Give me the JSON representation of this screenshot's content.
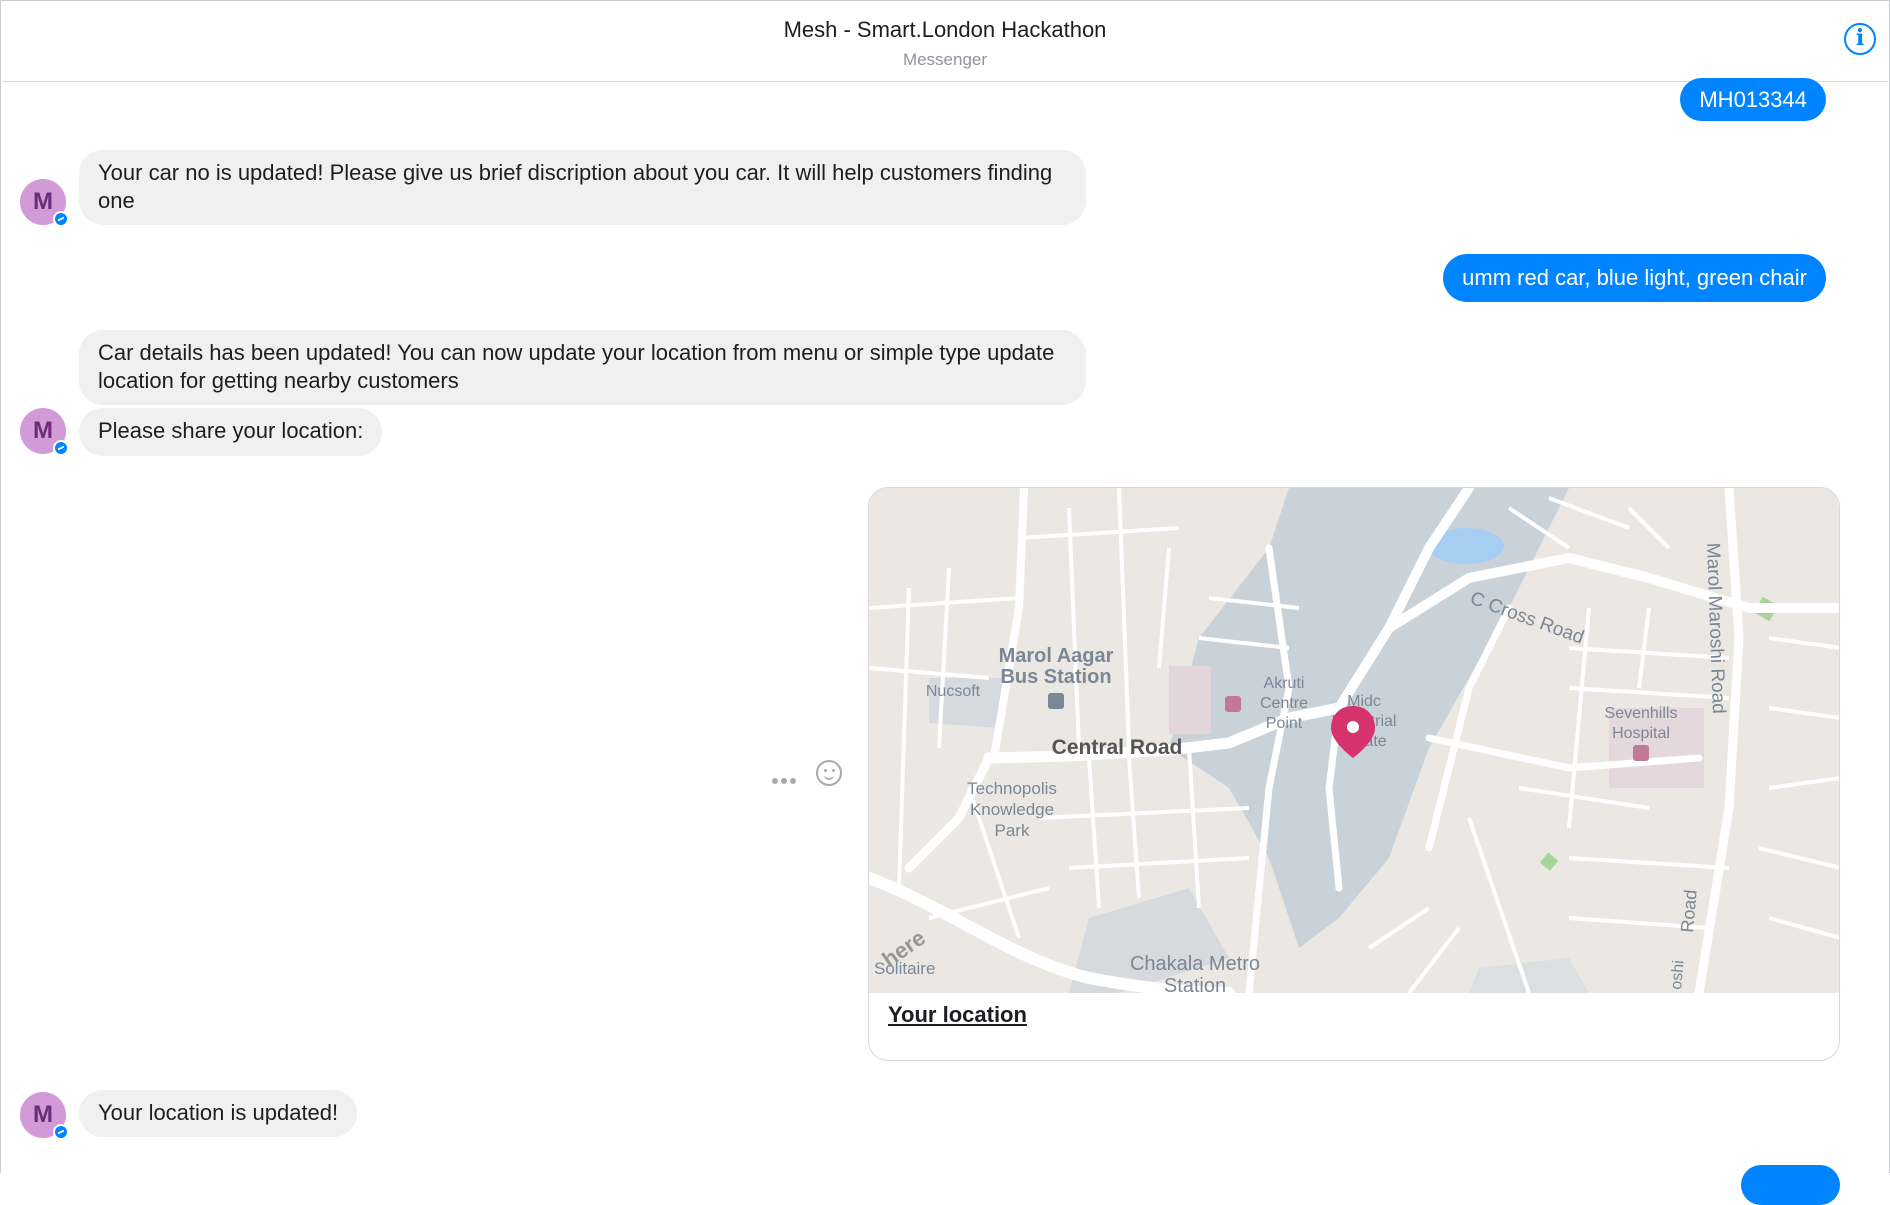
{
  "header": {
    "title": "Mesh - Smart.London Hackathon",
    "subtitle": "Messenger",
    "info_icon": "info-icon"
  },
  "bot": {
    "avatar_letter": "M",
    "avatar_color": "#d39ad8",
    "badge_icon": "messenger-badge-icon"
  },
  "messages": {
    "out_car_no": "MH013344",
    "in_car_updated": "Your car no is updated! Please give us brief discription about you car. It will help customers finding one",
    "out_description": "umm red car, blue light, green chair",
    "in_details_updated": "Car details has been updated! You can now update your location from menu or simple type update location for getting nearby customers",
    "in_share_location": "Please share your location:",
    "in_location_updated": "Your location is updated!"
  },
  "location_card": {
    "caption": "Your location",
    "map_labels": {
      "bus_station_1": "Marol Aagar",
      "bus_station_2": "Bus Station",
      "nucsoft": "Nucsoft",
      "central_road": "Central Road",
      "akruti_1": "Akruti",
      "akruti_2": "Centre",
      "akruti_3": "Point",
      "midc_1": "Midc",
      "midc_2": "Industrial",
      "midc_3": "Estate",
      "c_cross_road": "C Cross Road",
      "marol_maroshi_road": "Marol Maroshi Road",
      "sevenhills_1": "Sevenhills",
      "sevenhills_2": "Hospital",
      "technopolis_1": "Technopolis",
      "technopolis_2": "Knowledge",
      "technopolis_3": "Park",
      "chakala_1": "Chakala Metro",
      "chakala_2": "Station",
      "solitaire": "Solitaire",
      "road_right": "Road",
      "oshi": "oshi",
      "here_logo": "here"
    },
    "pin_icon": "map-pin-icon"
  },
  "actions": {
    "more_icon": "more-dots-icon",
    "react_icon": "smiley-icon"
  },
  "colors": {
    "outgoing": "#0084ff",
    "incoming": "#f1f0f0",
    "map_bg": "#ebe8e3",
    "pin": "#d6336c"
  }
}
